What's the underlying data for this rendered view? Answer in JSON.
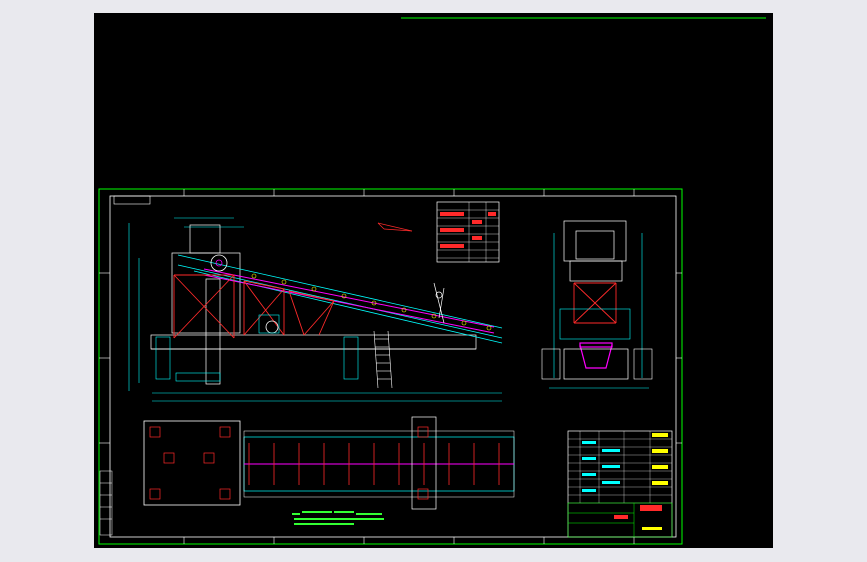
{
  "viewport": {
    "background": "#000000",
    "page_background": "#e9e9ee"
  },
  "colors": {
    "frame": "#00ff00",
    "cyan": "#00ffff",
    "white": "#ffffff",
    "magenta": "#ff00ff",
    "red": "#ff2a2a",
    "yellow": "#ffff00",
    "green_text": "#33ff33"
  },
  "sheet": {
    "top_rule": true,
    "title_block_visible": true
  }
}
